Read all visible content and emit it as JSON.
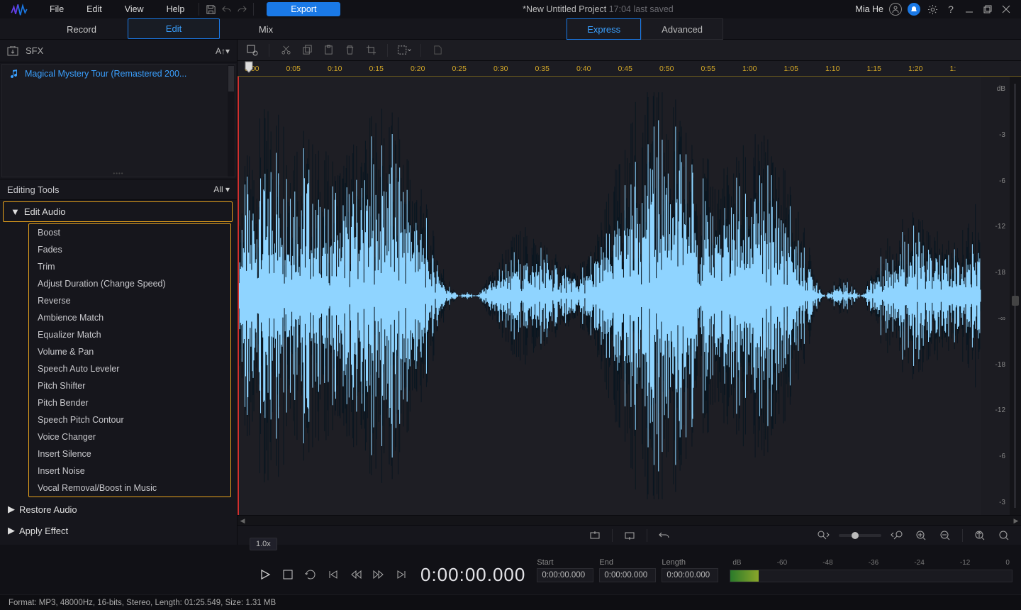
{
  "menu": {
    "items": [
      "File",
      "Edit",
      "View",
      "Help"
    ]
  },
  "export_label": "Export",
  "title": "*New Untitled Project",
  "title_ts": "17:04 last saved",
  "user": "Mia He",
  "main_tabs": [
    "Record",
    "Edit",
    "Mix"
  ],
  "main_active": 1,
  "sub_tabs": [
    "Express",
    "Advanced"
  ],
  "sub_active": 0,
  "sb_top_label": "SFX",
  "media_item": "Magical Mystery Tour (Remastered 200...",
  "tools_title": "Editing Tools",
  "tools_filter": "All",
  "groups": {
    "g0": "Edit Audio",
    "g1": "Restore Audio",
    "g2": "Apply Effect"
  },
  "edit_items": [
    "Boost",
    "Fades",
    "Trim",
    "Adjust Duration (Change Speed)",
    "Reverse",
    "Ambience Match",
    "Equalizer Match",
    "Volume & Pan",
    "Speech Auto Leveler",
    "Pitch Shifter",
    "Pitch Bender",
    "Speech Pitch Contour",
    "Voice Changer",
    "Insert Silence",
    "Insert Noise",
    "Vocal Removal/Boost in Music"
  ],
  "ruler": [
    "0:00",
    "0:05",
    "0:10",
    "0:15",
    "0:20",
    "0:25",
    "0:30",
    "0:35",
    "0:40",
    "0:45",
    "0:50",
    "0:55",
    "1:00",
    "1:05",
    "1:10",
    "1:15",
    "1:20",
    "1:"
  ],
  "db_top": "dB",
  "db_labels": [
    "-3",
    "-6",
    "-12",
    "-18",
    "-∞",
    "-18",
    "-12",
    "-6",
    "-3"
  ],
  "speed": "1.0x",
  "time_main": "0:00:00.000",
  "t_start_l": "Start",
  "t_end_l": "End",
  "t_len_l": "Length",
  "t_start": "0:00:00.000",
  "t_end": "0:00:00.000",
  "t_len": "0:00:00.000",
  "meter_ticks": [
    "dB",
    "-60",
    "-48",
    "-36",
    "-24",
    "-12",
    "0"
  ],
  "status": "Format: MP3, 48000Hz, 16-bits, Stereo, Length: 01:25.549, Size: 1.31 MB"
}
